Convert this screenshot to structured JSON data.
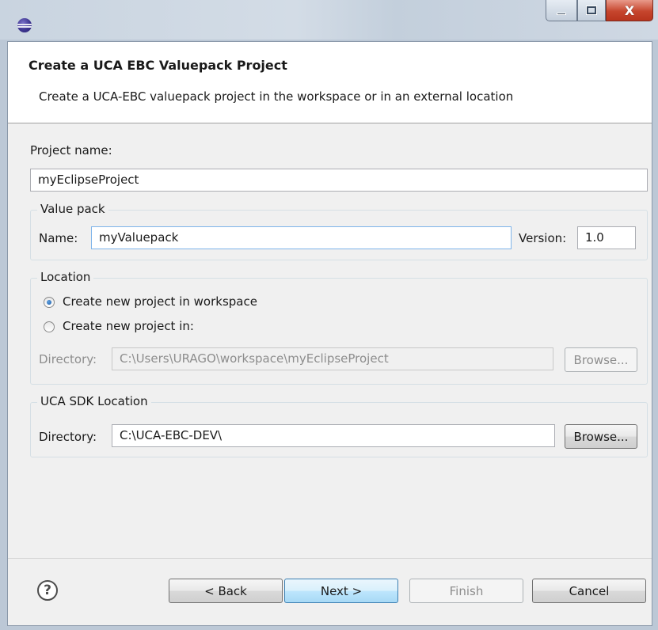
{
  "window": {
    "title_icon": "eclipse-icon",
    "controls": {
      "minimize": "minimize-icon",
      "maximize": "maximize-icon",
      "close": "X"
    }
  },
  "header": {
    "title": "Create a UCA EBC Valuepack Project",
    "description": "Create a UCA-EBC valuepack project in the workspace or in an external location"
  },
  "project": {
    "label": "Project name:",
    "value": "myEclipseProject"
  },
  "valuepack": {
    "group_title": "Value pack",
    "name_label": "Name:",
    "name_value": "myValuepack",
    "version_label": "Version:",
    "version_value": "1.0"
  },
  "location": {
    "group_title": "Location",
    "option_workspace": "Create new project in workspace",
    "option_custom": "Create new project in:",
    "selected": "workspace",
    "directory_label": "Directory:",
    "directory_value": "C:\\Users\\URAGO\\workspace\\myEclipseProject",
    "browse_label": "Browse..."
  },
  "sdk": {
    "group_title": "UCA SDK Location",
    "directory_label": "Directory:",
    "directory_value": "C:\\UCA-EBC-DEV\\",
    "browse_label": "Browse..."
  },
  "footer": {
    "help_glyph": "?",
    "back_label": "< Back",
    "next_label": "Next >",
    "finish_label": "Finish",
    "cancel_label": "Cancel"
  }
}
